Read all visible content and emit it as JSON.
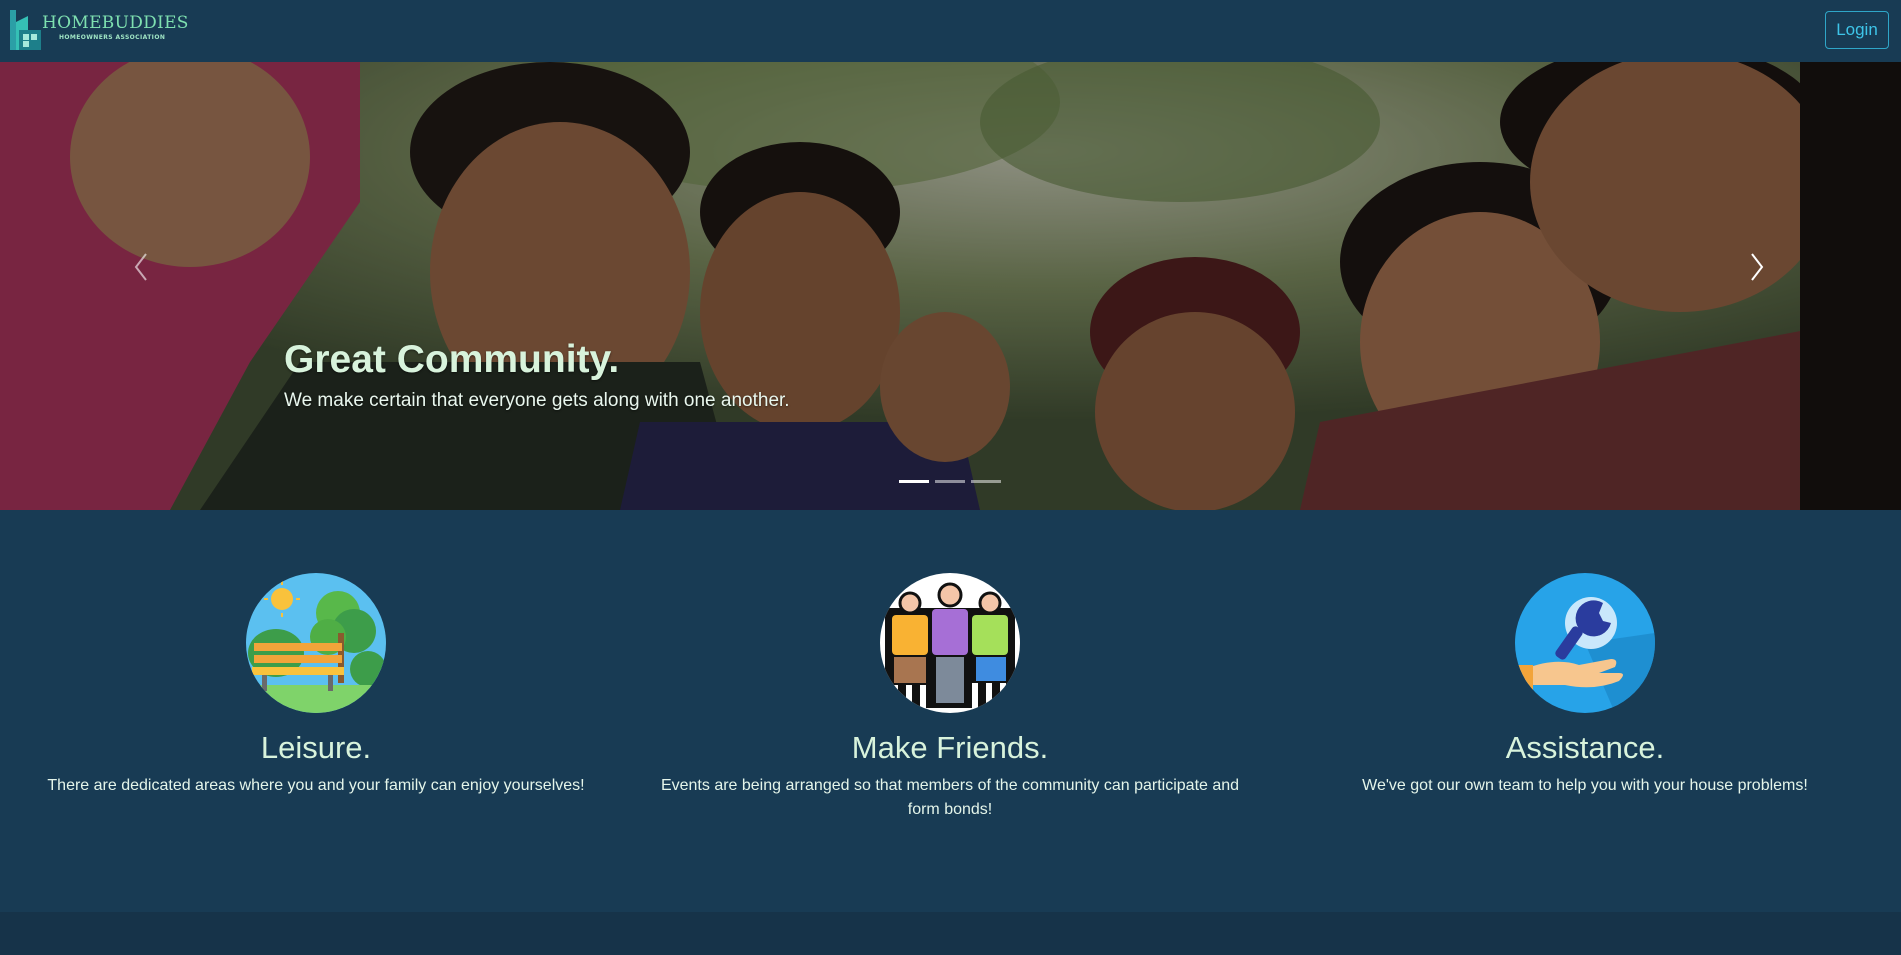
{
  "brand": {
    "name": "HOMEBUDDIES",
    "subtitle": "HOMEOWNERS ASSOCIATION"
  },
  "nav": {
    "login_label": "Login"
  },
  "carousel": {
    "active_slide": 1,
    "slide_count": 3,
    "caption_title": "Great Community.",
    "caption_text": "We make certain that everyone gets along with one another.",
    "prev_icon": "chevron-left-icon",
    "next_icon": "chevron-right-icon"
  },
  "features": [
    {
      "icon": "park-bench-icon",
      "title": "Leisure.",
      "text": "There are dedicated areas where you and your family can enjoy yourselves!"
    },
    {
      "icon": "friends-group-icon",
      "title": "Make Friends.",
      "text_line1": "Events are being arranged so that members of the community can participate and",
      "text_line2": "form bonds!"
    },
    {
      "icon": "wrench-hand-icon",
      "title": "Assistance.",
      "text": "We've got our own team to help you with your house problems!"
    }
  ],
  "colors": {
    "background": "#183b54",
    "accent_text": "#d8f3dc",
    "login_border": "#2fa6c8"
  }
}
